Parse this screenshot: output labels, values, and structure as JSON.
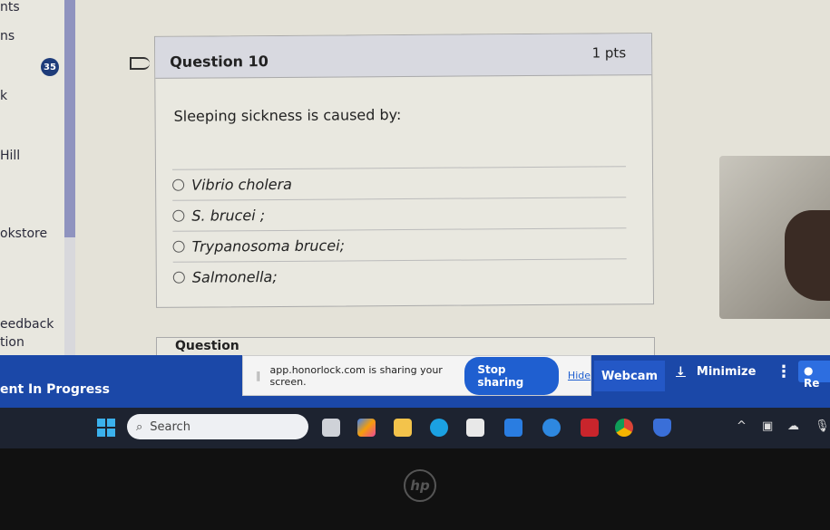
{
  "sidebar": {
    "items": [
      "nts",
      "ns",
      "k",
      "Hill",
      "okstore",
      "eedback",
      "tion"
    ],
    "badge": "35"
  },
  "question": {
    "title": "Question 10",
    "points": "1 pts",
    "text": "Sleeping sickness is caused by:",
    "answers": [
      "Vibrio cholera",
      "S. brucei ;",
      "Trypanosoma brucei;",
      "Salmonella;"
    ]
  },
  "next_question": {
    "title": "Question"
  },
  "proctor": {
    "status": "ent In Progress",
    "share_text": "app.honorlock.com is sharing your screen.",
    "stop_label": "Stop sharing",
    "hide_label": "Hide",
    "webcam_label": "Webcam",
    "minimize_label": "Minimize",
    "record_label": "Re"
  },
  "taskbar": {
    "search_placeholder": "Search"
  },
  "laptop": {
    "brand": "hp"
  },
  "colors": {
    "accent": "#1b48a8",
    "button": "#1f5fd0",
    "badge": "#1e3c7a"
  }
}
